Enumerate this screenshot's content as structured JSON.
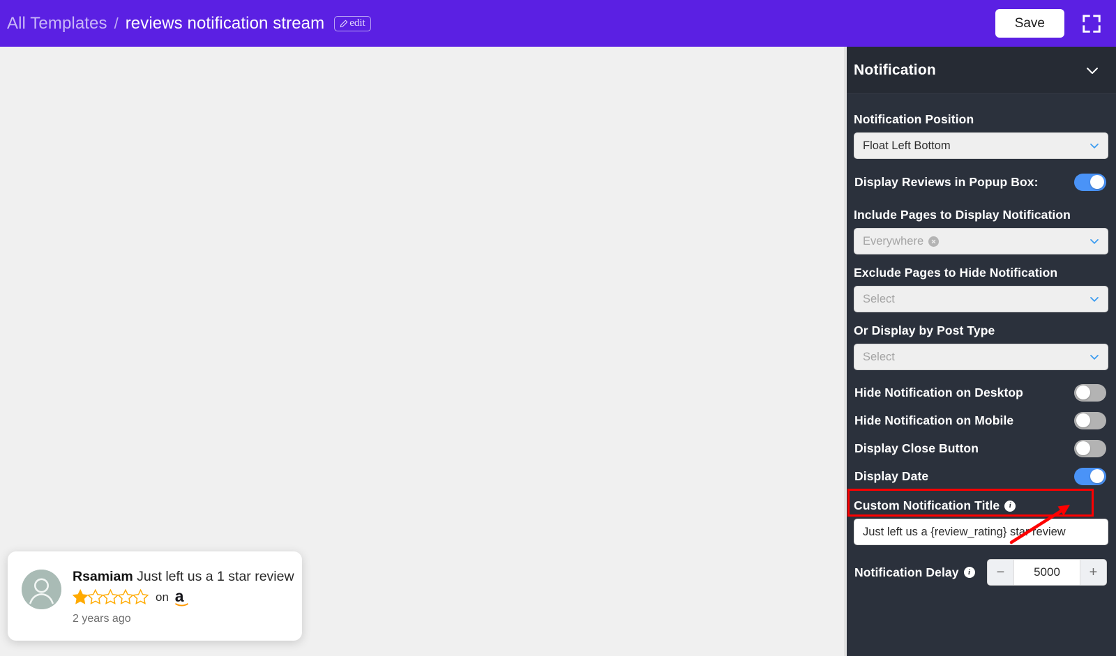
{
  "header": {
    "breadcrumb_root": "All Templates",
    "breadcrumb_separator": "/",
    "breadcrumb_current": "reviews notification stream",
    "edit_badge_label": "edit",
    "save_label": "Save",
    "brand_color": "#5B20E3"
  },
  "preview": {
    "user": "Rsamiam",
    "message": "Just left us a 1 star review",
    "rating": 1,
    "max_rating": 5,
    "on_label": "on",
    "source": "amazon",
    "date": "2 years ago",
    "star_color": "#FFAA00"
  },
  "sidebar": {
    "panel_title": "Notification",
    "position": {
      "label": "Notification Position",
      "value": "Float Left Bottom"
    },
    "popup_toggle": {
      "label": "Display Reviews in Popup Box:",
      "on": true
    },
    "include_pages": {
      "label": "Include Pages to Display Notification",
      "tag": "Everywhere"
    },
    "exclude_pages": {
      "label": "Exclude Pages to Hide Notification",
      "placeholder": "Select"
    },
    "post_type": {
      "label": "Or Display by Post Type",
      "placeholder": "Select"
    },
    "toggles": [
      {
        "label": "Hide Notification on Desktop",
        "on": false
      },
      {
        "label": "Hide Notification on Mobile",
        "on": false
      },
      {
        "label": "Display Close Button",
        "on": false
      },
      {
        "label": "Display Date",
        "on": true
      }
    ],
    "custom_title": {
      "label": "Custom Notification Title",
      "value": "Just left us a {review_rating} star review"
    },
    "delay": {
      "label": "Notification Delay",
      "value": "5000",
      "minus": "−",
      "plus": "+"
    },
    "accent_on_color": "#4A93F7",
    "accent_off_color": "#B3B3B3"
  },
  "annotation": {
    "color": "#FE0000",
    "target": "Display Date"
  }
}
